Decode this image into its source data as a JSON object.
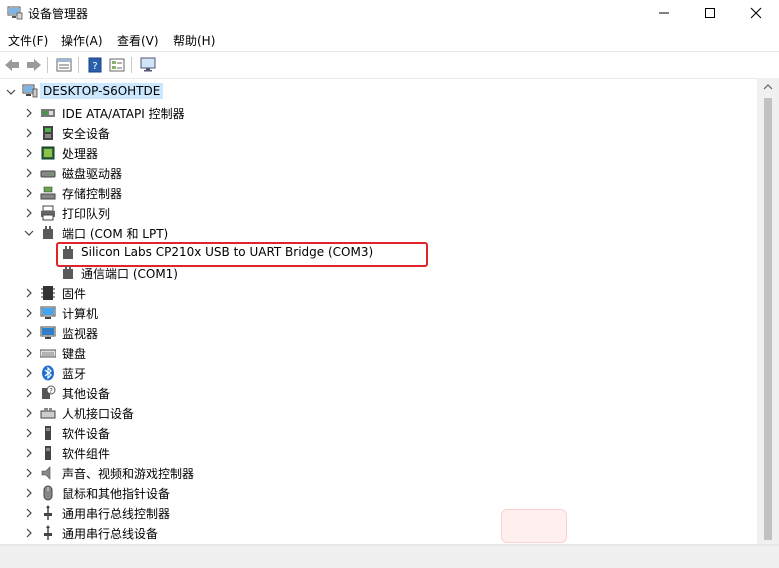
{
  "window": {
    "title": "设备管理器",
    "minimize_glyph": "—",
    "maximize_glyph": "☐",
    "close_glyph": "✕"
  },
  "menu": {
    "items": [
      {
        "label": "文件(F)"
      },
      {
        "label": "操作(A)"
      },
      {
        "label": "查看(V)"
      },
      {
        "label": "帮助(H)"
      }
    ]
  },
  "toolbar": {
    "icons": [
      "back-arrow-icon",
      "forward-arrow-icon",
      "properties-icon",
      "help-icon",
      "details-icon",
      "monitor-icon"
    ]
  },
  "tree": {
    "root": {
      "label": "DESKTOP-S6OHTDE",
      "expanded": true
    },
    "categories": [
      {
        "label": "IDE ATA/ATAPI 控制器",
        "icon": "ide-controller-icon"
      },
      {
        "label": "安全设备",
        "icon": "security-device-icon"
      },
      {
        "label": "处理器",
        "icon": "processor-icon"
      },
      {
        "label": "磁盘驱动器",
        "icon": "disk-drive-icon"
      },
      {
        "label": "存储控制器",
        "icon": "storage-controller-icon"
      },
      {
        "label": "打印队列",
        "icon": "printer-icon"
      },
      {
        "label": "端口 (COM 和 LPT)",
        "icon": "port-icon",
        "expanded": true,
        "children": [
          {
            "label": "Silicon Labs CP210x USB to UART Bridge (COM3)",
            "icon": "port-device-icon",
            "highlighted": true
          },
          {
            "label": "通信端口 (COM1)",
            "icon": "port-device-icon"
          }
        ]
      },
      {
        "label": "固件",
        "icon": "firmware-icon"
      },
      {
        "label": "计算机",
        "icon": "computer-icon"
      },
      {
        "label": "监视器",
        "icon": "monitor-icon"
      },
      {
        "label": "键盘",
        "icon": "keyboard-icon"
      },
      {
        "label": "蓝牙",
        "icon": "bluetooth-icon"
      },
      {
        "label": "其他设备",
        "icon": "other-devices-icon"
      },
      {
        "label": "人机接口设备",
        "icon": "hid-icon"
      },
      {
        "label": "软件设备",
        "icon": "software-device-icon"
      },
      {
        "label": "软件组件",
        "icon": "software-component-icon"
      },
      {
        "label": "声音、视频和游戏控制器",
        "icon": "sound-icon"
      },
      {
        "label": "鼠标和其他指针设备",
        "icon": "mouse-icon"
      },
      {
        "label": "通用串行总线控制器",
        "icon": "usb-controller-icon"
      },
      {
        "label": "通用串行总线设备",
        "icon": "usb-device-icon"
      }
    ]
  },
  "colors": {
    "selection": "#cce8ff",
    "highlight_border": "#e0242b",
    "port_icon": "#5a5a5a"
  }
}
